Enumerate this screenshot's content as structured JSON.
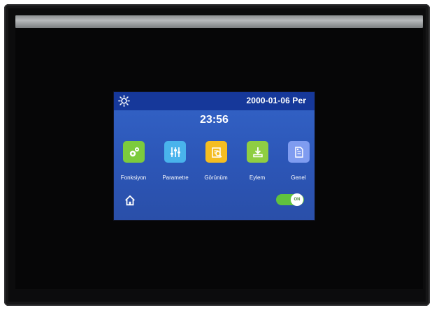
{
  "status_bar": {
    "brightness_icon": "sun-icon",
    "date": "2000-01-06 Per"
  },
  "clock": {
    "time": "23:56"
  },
  "menu": [
    {
      "label": "Fonksiyon",
      "icon": "gears-icon",
      "color": "#7ccb3d"
    },
    {
      "label": "Parametre",
      "icon": "sliders-icon",
      "color": "#49b3ec"
    },
    {
      "label": "Görünüm",
      "icon": "view-icon",
      "color": "#f4bd22"
    },
    {
      "label": "Eylem",
      "icon": "download-icon",
      "color": "#8fce42"
    },
    {
      "label": "Genel",
      "icon": "document-icon",
      "color": "#7f9cf0"
    }
  ],
  "footer": {
    "home_icon": "home-icon",
    "toggle_label": "ON",
    "toggle_on": true
  }
}
